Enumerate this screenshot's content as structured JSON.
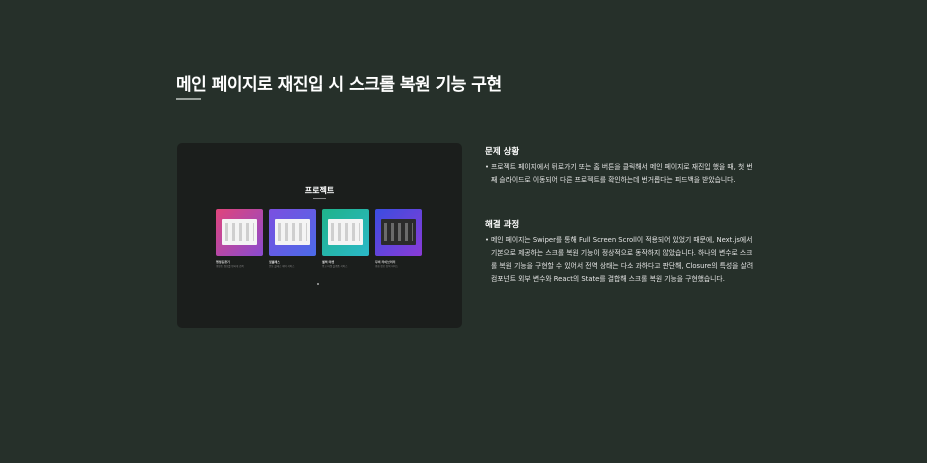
{
  "page": {
    "title": "메인 페이지로 재진입 시 스크롤 복원 기능 구현"
  },
  "preview": {
    "title": "프로젝트",
    "cards": [
      {
        "name": "행정동찾기",
        "desc": "행정동 정보를 편하게 검색",
        "colors": [
          "#e0457b",
          "#8a4bd0"
        ]
      },
      {
        "name": "핏클래스",
        "desc": "운동 클래스 예약 서비스",
        "colors": [
          "#7b4fe0",
          "#4b6be8"
        ]
      },
      {
        "name": "셀렉 마켓",
        "desc": "중고 마켓 플랫폼 서비스",
        "colors": [
          "#1fb38a",
          "#2bb8c8"
        ]
      },
      {
        "name": "무비 라이브러리",
        "desc": "영화 정보 검색 서비스",
        "colors": [
          "#3a4de0",
          "#8a3bd6"
        ]
      }
    ]
  },
  "problem": {
    "heading": "문제 상황",
    "text": "프로젝트 페이지에서 뒤로가기 또는 홈 버튼을 클릭해서 메인 페이지로 재진입 했을 때, 첫 번째 슬라이드로 이동되어 다른 프로젝트를 확인하는데 번거롭다는 피드백을 받았습니다."
  },
  "solution": {
    "heading": "해결 과정",
    "text": "메인 페이지는 Swiper를 통해 Full Screen Scroll이 적용되어 있었기 때문에, Next.js에서 기본으로 제공하는 스크롤 복원 기능이 정상적으로 동작하지 않았습니다. 하나의 변수로 스크롤 복원 기능을 구현할 수 있어서 전역 상태는 다소 과하다고 판단해, Closure의 특성을 살려 컴포넌트 외부 변수와 React의 State를 결합해 스크롤 복원 기능을 구현했습니다."
  }
}
